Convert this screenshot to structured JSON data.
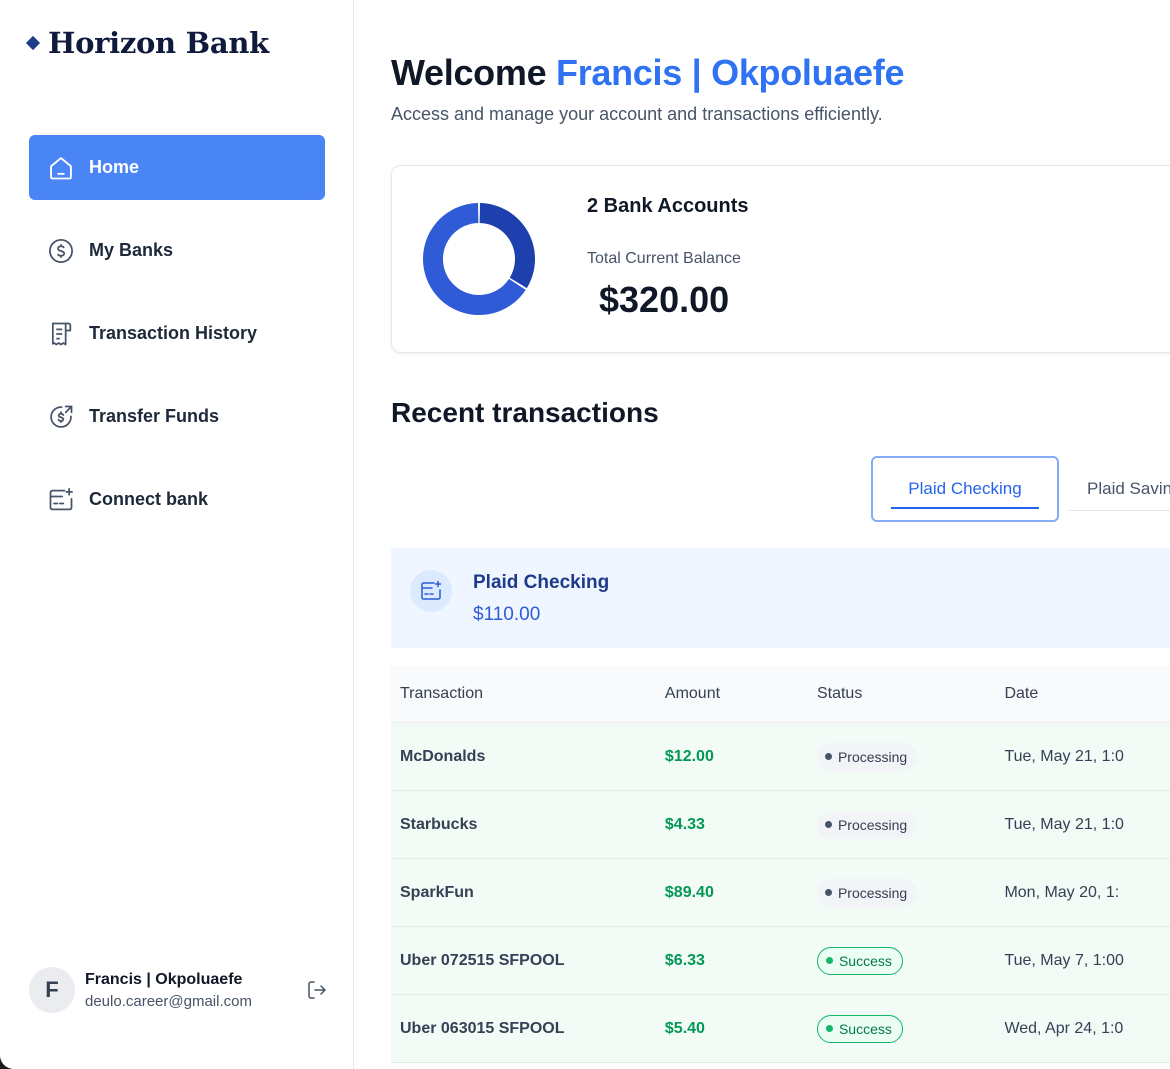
{
  "brand": {
    "name": "Horizon Bank"
  },
  "sidebar": {
    "items": [
      {
        "label": "Home",
        "icon": "home-icon",
        "active": true
      },
      {
        "label": "My Banks",
        "icon": "dollar-circle-icon"
      },
      {
        "label": "Transaction History",
        "icon": "receipt-icon"
      },
      {
        "label": "Transfer Funds",
        "icon": "money-send-icon"
      },
      {
        "label": "Connect bank",
        "icon": "card-add-icon"
      }
    ]
  },
  "user": {
    "initial": "F",
    "name": "Francis | Okpoluaefe",
    "email": "deulo.career@gmail.com"
  },
  "header": {
    "welcome": "Welcome",
    "name": "Francis | Okpoluaefe",
    "subtitle": "Access and manage your account and transactions efficiently."
  },
  "balance": {
    "accounts_label": "2 Bank Accounts",
    "total_label": "Total Current Balance",
    "total_value": "$320.00",
    "donut_colors": [
      "#1e40af",
      "#2f5bd6"
    ],
    "donut_shares": [
      0.34,
      0.66
    ]
  },
  "recent": {
    "title": "Recent transactions",
    "tabs": [
      "Plaid Checking",
      "Plaid Savin"
    ],
    "active_tab": 0
  },
  "account": {
    "name": "Plaid Checking",
    "balance": "$110.00"
  },
  "table": {
    "headers": [
      "Transaction",
      "Amount",
      "Status",
      "Date"
    ],
    "rows": [
      {
        "name": "McDonalds",
        "amount": "$12.00",
        "status": "Processing",
        "date": "Tue, May 21, 1:0"
      },
      {
        "name": "Starbucks",
        "amount": "$4.33",
        "status": "Processing",
        "date": "Tue, May 21, 1:0"
      },
      {
        "name": "SparkFun",
        "amount": "$89.40",
        "status": "Processing",
        "date": "Mon, May 20, 1:"
      },
      {
        "name": "Uber 072515 SFPOOL",
        "amount": "$6.33",
        "status": "Success",
        "date": "Tue, May 7, 1:00"
      },
      {
        "name": "Uber 063015 SFPOOL",
        "amount": "$5.40",
        "status": "Success",
        "date": "Wed, Apr 24, 1:0"
      }
    ]
  }
}
